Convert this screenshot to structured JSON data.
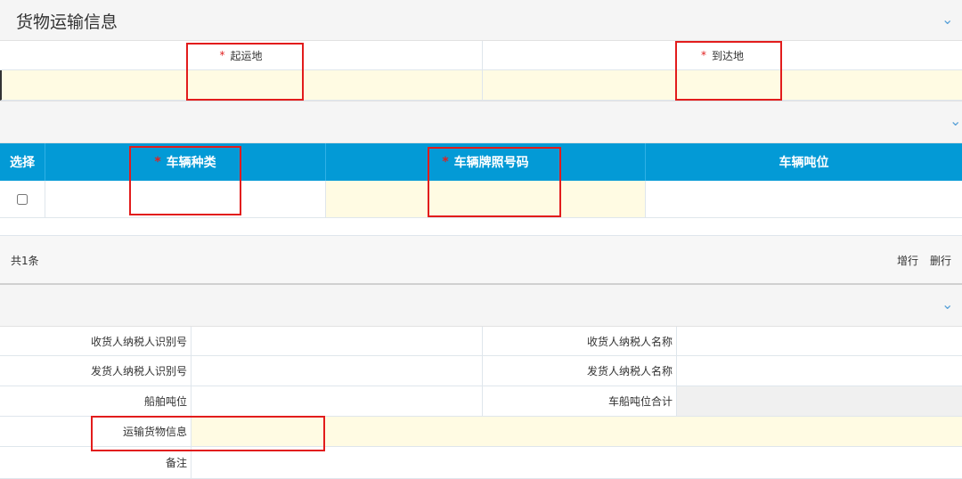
{
  "section1": {
    "title": "货物运输信息"
  },
  "route": {
    "required_mark": "*",
    "origin_label": "起运地",
    "destination_label": "到达地"
  },
  "vehicles": {
    "columns": {
      "select": "选择",
      "type": "车辆种类",
      "plate": "车辆牌照号码",
      "tonnage": "车辆吨位"
    },
    "required_mark": "*",
    "rows": [
      {
        "type": "",
        "plate": "",
        "tonnage": ""
      }
    ],
    "total": "共1条",
    "add_row": "增行",
    "delete_row": "删行"
  },
  "info": {
    "consignee_tax_id_label": "收货人纳税人识别号",
    "consignee_name_label": "收货人纳税人名称",
    "shipper_tax_id_label": "发货人纳税人识别号",
    "shipper_name_label": "发货人纳税人名称",
    "ship_tonnage_label": "船舶吨位",
    "vehicle_ship_tonnage_total_label": "车船吨位合计",
    "cargo_info_label": "运输货物信息",
    "remark_label": "备注"
  },
  "colors": {
    "accent": "#039ad6",
    "required": "#e02020",
    "highlight": "#e21c1c",
    "input_bg": "#fffbe3"
  }
}
